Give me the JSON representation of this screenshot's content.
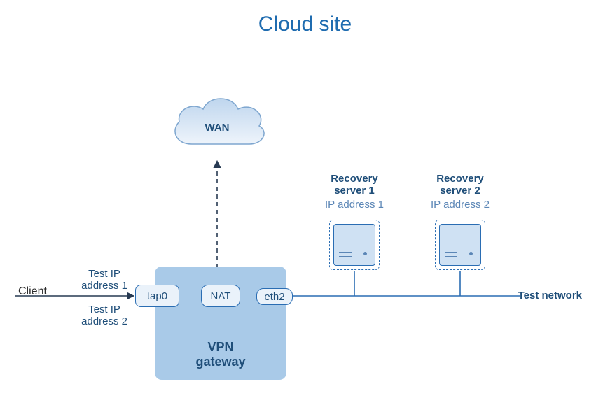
{
  "title": "Cloud site",
  "cloud": {
    "label": "WAN"
  },
  "vpn": {
    "label_l1": "VPN",
    "label_l2": "gateway"
  },
  "nodes": {
    "tap0": "tap0",
    "nat": "NAT",
    "eth2": "eth2"
  },
  "client": "Client",
  "test_ip1_l1": "Test IP",
  "test_ip1_l2": "address 1",
  "test_ip2_l1": "Test IP",
  "test_ip2_l2": "address 2",
  "test_network": "Test network",
  "servers": [
    {
      "title_l1": "Recovery",
      "title_l2": "server 1",
      "ip": "IP address 1"
    },
    {
      "title_l1": "Recovery",
      "title_l2": "server 2",
      "ip": "IP address 2"
    }
  ]
}
